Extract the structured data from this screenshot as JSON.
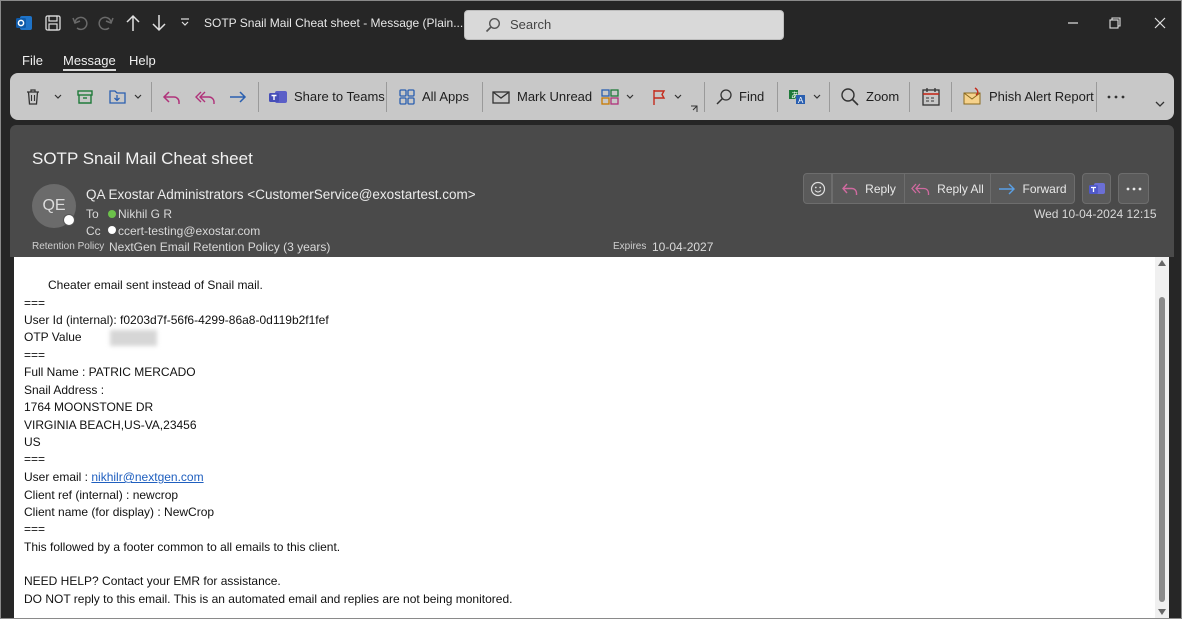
{
  "titlebar": {
    "title": "SOTP Snail Mail Cheat sheet  -  Message (Plain...",
    "search_placeholder": "Search"
  },
  "menu": [
    "File",
    "Message",
    "Help"
  ],
  "ribbon": {
    "share_teams": "Share to Teams",
    "all_apps": "All Apps",
    "mark_unread": "Mark Unread",
    "find": "Find",
    "zoom": "Zoom",
    "phish": "Phish Alert Report"
  },
  "message": {
    "subject": "SOTP Snail Mail Cheat sheet",
    "avatar_initials": "QE",
    "from": "QA Exostar Administrators <CustomerService@exostartest.com>",
    "to_label": "To",
    "to": "Nikhil G R",
    "cc_label": "Cc",
    "cc": "ccert-testing@exostar.com",
    "retention_label": "Retention Policy",
    "retention": "NextGen Email Retention Policy (3 years)",
    "expires_label": "Expires",
    "expires": "10-04-2027",
    "date": "Wed 10-04-2024 12:15",
    "reply": "Reply",
    "reply_all": "Reply All",
    "forward": "Forward"
  },
  "body": {
    "l1": "Cheater email sent instead of Snail mail.",
    "sep": "===",
    "user_id": "User Id (internal): f0203d7f-56f6-4299-86a8-0d119b2f1fef",
    "otp": "OTP Value",
    "full_name": "Full Name : PATRIC MERCADO",
    "snail": "Snail Address :",
    "addr1": "1764 MOONSTONE DR",
    "addr2": "VIRGINIA BEACH,US-VA,23456",
    "addr3": "US",
    "email_label": "User email : ",
    "email": "nikhilr@nextgen.com",
    "client_ref": "Client ref (internal) : newcrop",
    "client_name": "Client name (for display) : NewCrop",
    "footer_note": "This followed by a footer common to all emails to this client.",
    "help": "NEED HELP?  Contact your EMR for assistance.",
    "noreply": "DO NOT reply to this email. This is an automated email and replies are not being monitored."
  },
  "colors": {
    "accent_blue": "#2a78d6",
    "green_dot": "#6cc24a",
    "ribbon_bg": "#c8c8c8"
  }
}
